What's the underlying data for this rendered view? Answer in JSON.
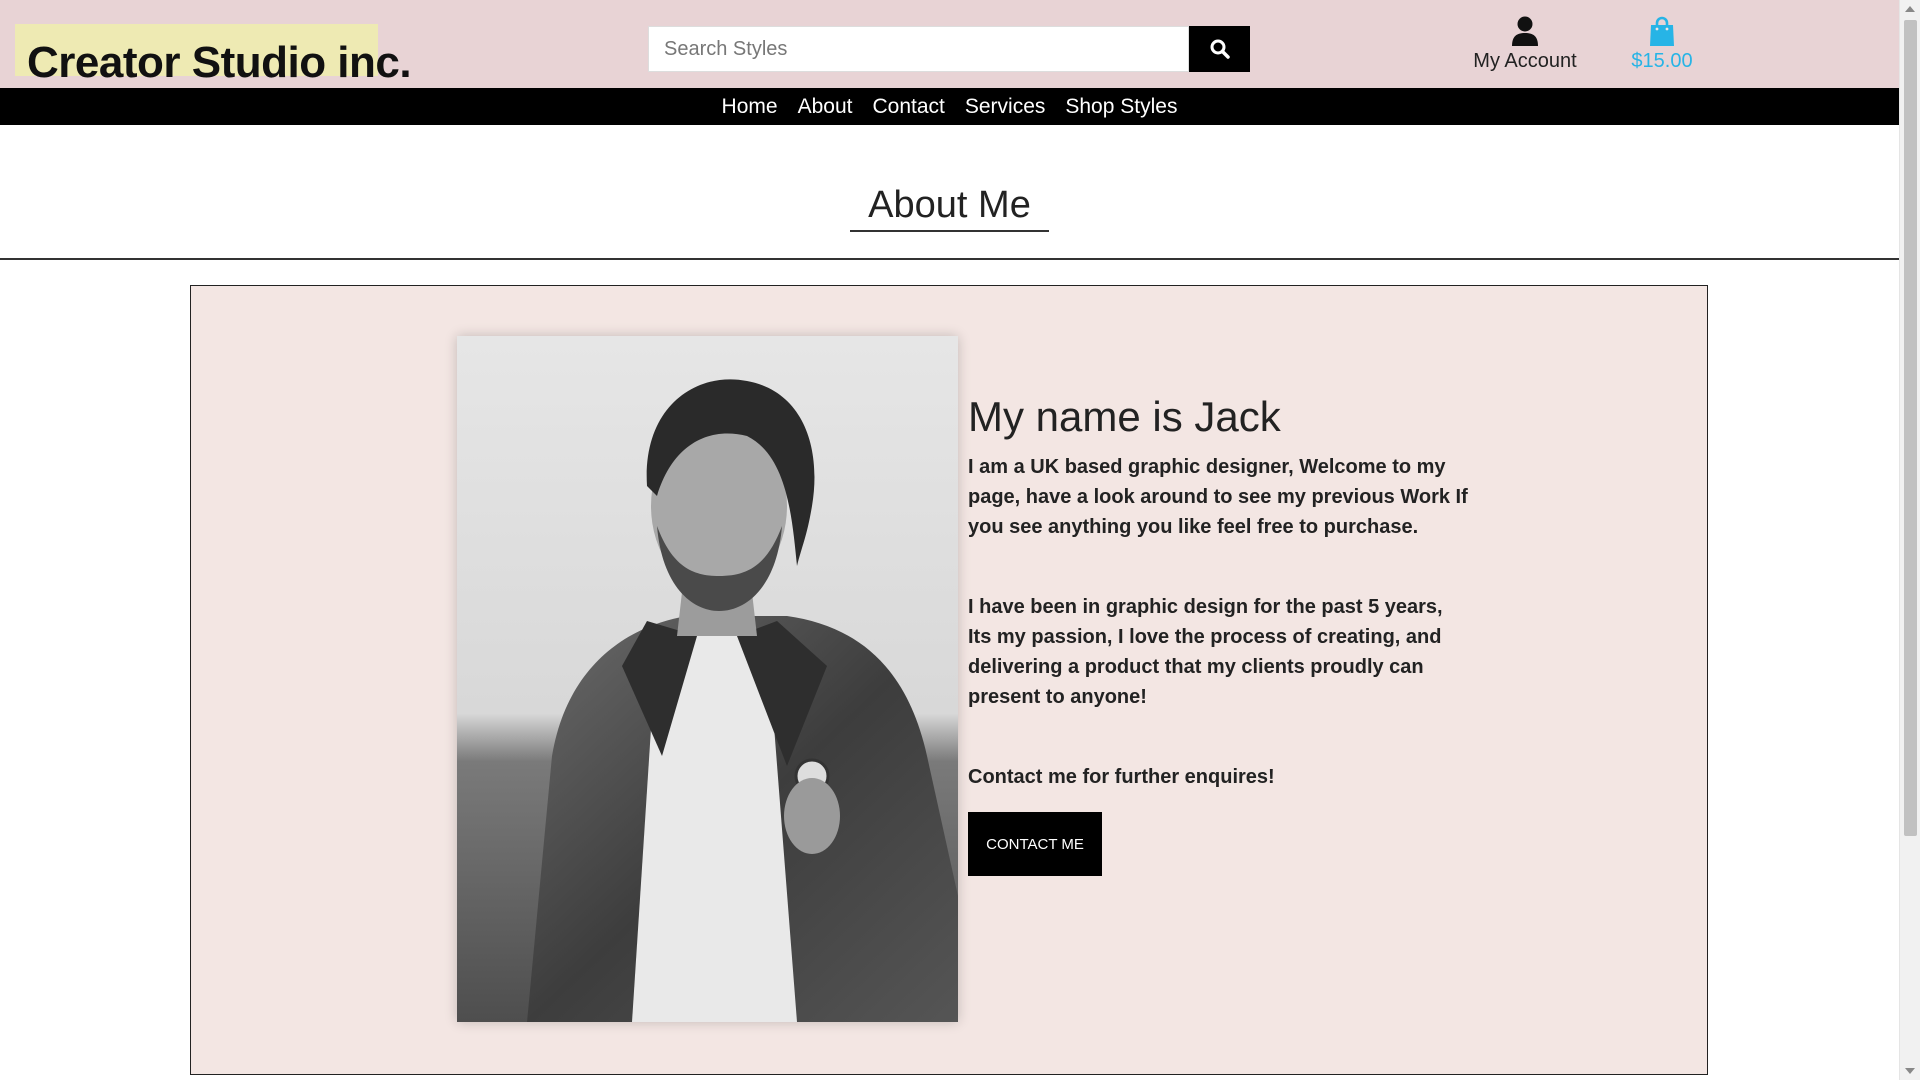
{
  "brand": {
    "name": "Creator Studio inc."
  },
  "search": {
    "placeholder": "Search Styles",
    "button_icon": "search-icon"
  },
  "account": {
    "label": "My Account",
    "icon": "user-icon"
  },
  "cart": {
    "total": "$15.00",
    "icon": "shopping-bag-icon",
    "color": "#27b4e6"
  },
  "nav": {
    "items": [
      "Home",
      "About",
      "Contact",
      "Services",
      "Shop Styles"
    ]
  },
  "page": {
    "title": "About Me"
  },
  "about": {
    "heading": "My name is Jack",
    "paragraphs": [
      "I am a UK based graphic designer, Welcome to my page, have a look around to see my previous Work If you see anything you like feel free to purchase.",
      "I have been in graphic design for the past 5 years, Its my passion, I love the process of creating, and delivering a product that my clients proudly can present to anyone!",
      "Contact me for further enquires!"
    ],
    "button_label": "CONTACT ME"
  },
  "colors": {
    "header_bg": "#e8d3d5",
    "logo_bg": "#eeeab3",
    "nav_bg": "#000000",
    "card_bg": "#f3e6e3",
    "accent": "#27b4e6"
  }
}
